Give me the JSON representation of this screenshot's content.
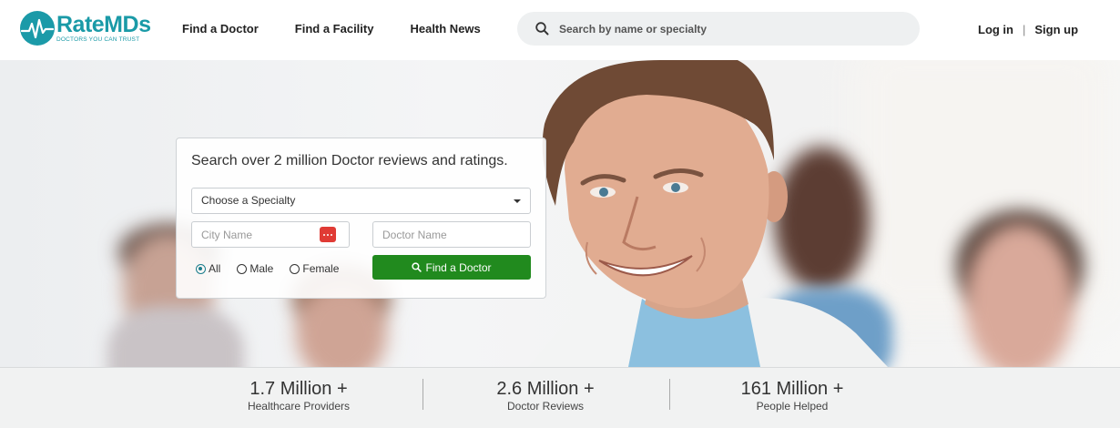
{
  "header": {
    "logo_name": "RateMDs",
    "logo_tagline": "DOCTORS YOU CAN TRUST",
    "nav": [
      "Find a Doctor",
      "Find a Facility",
      "Health News"
    ],
    "search_placeholder": "Search by name or specialty",
    "login": "Log in",
    "separator": "|",
    "signup": "Sign up"
  },
  "search_card": {
    "title": "Search over 2 million Doctor reviews and ratings.",
    "specialty_select": "Choose a Specialty",
    "city_placeholder": "City Name",
    "doctor_placeholder": "Doctor Name",
    "gender_options": [
      "All",
      "Male",
      "Female"
    ],
    "gender_selected": "All",
    "find_button": "Find a Doctor"
  },
  "stats": [
    {
      "value": "1.7 Million +",
      "label": "Healthcare Providers"
    },
    {
      "value": "2.6 Million +",
      "label": "Doctor Reviews"
    },
    {
      "value": "161 Million +",
      "label": "People Helped"
    }
  ],
  "colors": {
    "brand": "#1a9aa7",
    "find_button": "#218a1e",
    "city_icon": "#e03b35"
  }
}
